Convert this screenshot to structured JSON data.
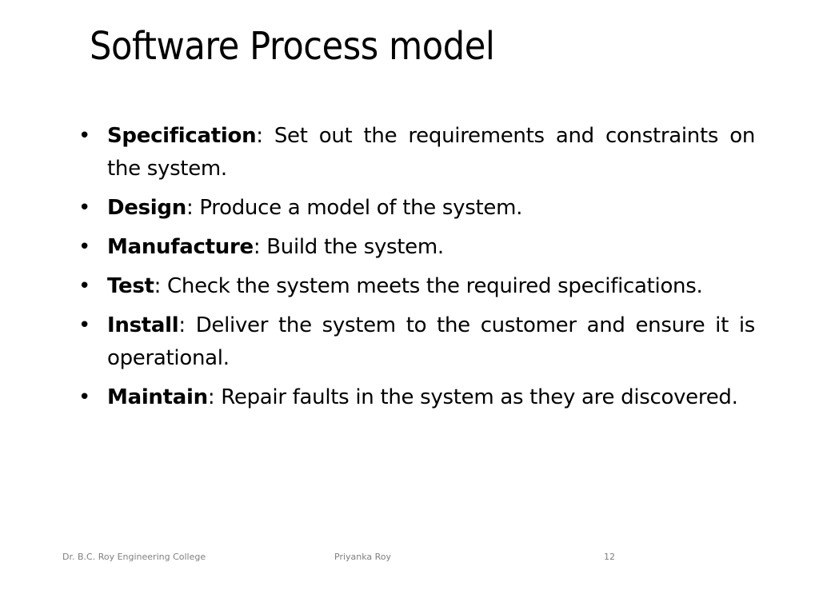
{
  "slide": {
    "title": "Software Process model",
    "bullet_glyph": "•",
    "bullets": [
      {
        "term": "Specification",
        "separator": ":",
        "text": " Set out the requirements and constraints on the system."
      },
      {
        "term": "Design",
        "separator": ":",
        "text": " Produce a model of the system."
      },
      {
        "term": "Manufacture",
        "separator": ":",
        "text": " Build the system."
      },
      {
        "term": "Test",
        "separator": ":",
        "text": " Check the system meets the required specifications."
      },
      {
        "term": "Install",
        "separator": ":",
        "text": " Deliver the system to the customer and ensure it is operational."
      },
      {
        "term": "Maintain",
        "separator": ":",
        "text": " Repair faults in the system as they are discovered."
      }
    ]
  },
  "footer": {
    "left": "Dr. B.C. Roy Engineering College",
    "center": "Priyanka Roy",
    "page_number": "12"
  }
}
